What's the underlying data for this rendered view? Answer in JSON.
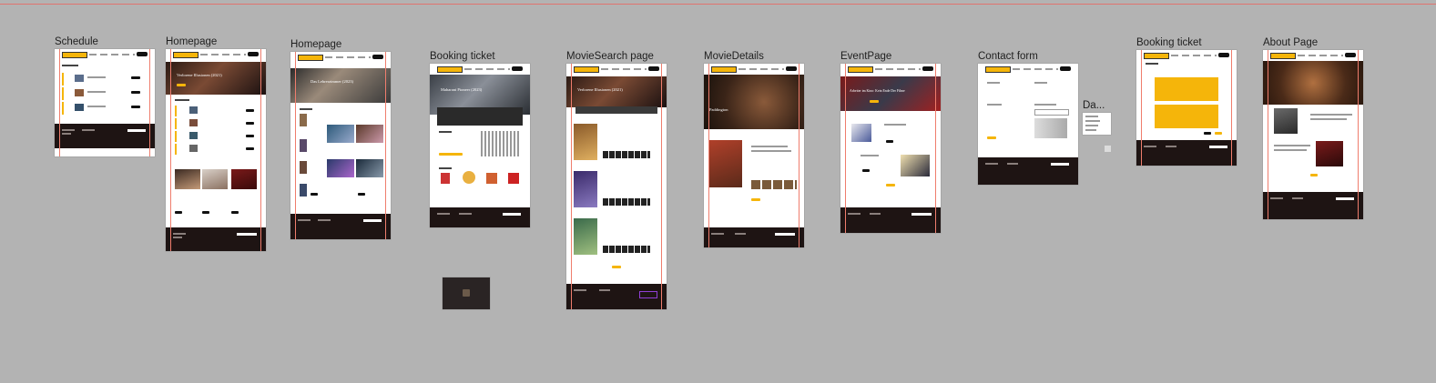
{
  "canvas": {
    "frame_labels": {
      "schedule": "Schedule",
      "homepage_1": "Homepage",
      "homepage_2": "Homepage",
      "booking_ticket_1": "Booking ticket",
      "movie_search": "MovieSearch page",
      "movie_details": "MovieDetails",
      "event_page": "EventPage",
      "contact_form": "Contact form",
      "da_truncated": "Da...",
      "booking_ticket_2": "Booking ticket",
      "about_page": "About Page"
    },
    "hero_titles": {
      "homepage_1": "Verlorene Illusionen (2021)",
      "homepage_2": "Das Lehrerzimmer (2023)",
      "booking_ticket_1": "Maharani Pioneer (2023)",
      "movie_search": "Verlorene Illusionen (2021)",
      "movie_details": "Paddington",
      "event_page": "Arbeiter im Kino: Kein Ende Der Filme"
    },
    "colors": {
      "canvas_bg": "#b3b3b3",
      "accent_yellow": "#f5b50a",
      "footer_dark": "#1e1413",
      "guide_red": "#ef7d6d",
      "purple": "#8f3fd6"
    }
  }
}
